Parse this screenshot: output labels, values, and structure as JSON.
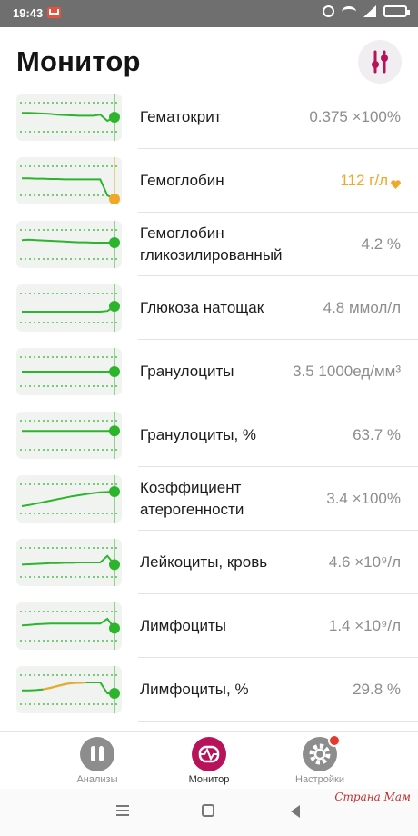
{
  "status_bar": {
    "time": "19:43"
  },
  "header": {
    "title": "Монитор",
    "filter_icon": "sliders-icon"
  },
  "colors": {
    "ok": "#2cb52c",
    "warn": "#f1a728",
    "accent": "#b8135a",
    "badge": "#e43a2e"
  },
  "items": [
    {
      "name": "Гематокрит",
      "value": "0.375 ×100%",
      "status": "ok",
      "trend": [
        62,
        62,
        61,
        60,
        59,
        57,
        56,
        55,
        54,
        54,
        54,
        57,
        40,
        50
      ]
    },
    {
      "name": "Гемоглобин",
      "value": "112 г/л",
      "status": "warn",
      "trend": [
        57,
        57,
        56,
        56,
        55,
        55,
        54,
        54,
        54,
        54,
        54,
        54,
        10,
        0
      ]
    },
    {
      "name": "Гемоглобин гликозилированный",
      "value": "4.2 %",
      "status": "ok",
      "trend": [
        62,
        63,
        62,
        61,
        60,
        59,
        58,
        57,
        56,
        56,
        55,
        55,
        55,
        55
      ]
    },
    {
      "name": "Глюкоза натощак",
      "value": "4.8 ммол/л",
      "status": "ok",
      "trend": [
        40,
        40,
        40,
        40,
        40,
        40,
        40,
        40,
        40,
        40,
        40,
        40,
        42,
        55
      ]
    },
    {
      "name": "Гранулоциты",
      "value": "3.5 1000ед/мм³",
      "status": "ok",
      "trend": [
        50,
        50,
        50,
        50,
        50,
        50,
        50,
        50,
        50,
        50,
        50,
        50,
        50,
        50
      ]
    },
    {
      "name": "Гранулоциты, %",
      "value": "63.7 %",
      "status": "ok",
      "trend": [
        62,
        62,
        62,
        62,
        62,
        62,
        62,
        62,
        62,
        62,
        62,
        62,
        62,
        62
      ]
    },
    {
      "name": "Коэффициент атерогенности",
      "value": "3.4 ×100%",
      "status": "ok",
      "trend": [
        30,
        33,
        37,
        41,
        45,
        49,
        53,
        57,
        60,
        63,
        66,
        68,
        69,
        70
      ]
    },
    {
      "name": "Лейкоциты, кровь",
      "value": "4.6 ×10⁹/л",
      "status": "ok",
      "trend": [
        44,
        45,
        46,
        47,
        48,
        48,
        49,
        49,
        50,
        50,
        50,
        50,
        68,
        44
      ]
    },
    {
      "name": "Лимфоциты",
      "value": "1.4 ×10⁹/л",
      "status": "ok",
      "trend": [
        52,
        53,
        55,
        56,
        57,
        57,
        57,
        57,
        57,
        57,
        57,
        57,
        70,
        44
      ]
    },
    {
      "name": "Лимфоциты, %",
      "value": "29.8 %",
      "status": "ok",
      "trend": [
        48,
        48,
        49,
        51,
        55,
        60,
        65,
        68,
        69,
        70,
        70,
        70,
        40,
        40
      ],
      "warn_segment": true
    }
  ],
  "bottom_nav": {
    "tabs": [
      {
        "label": "Анализы",
        "icon": "tubes-icon"
      },
      {
        "label": "Монитор",
        "icon": "monitor-pulse-icon"
      },
      {
        "label": "Настройки",
        "icon": "gear-icon"
      }
    ],
    "active": "Монитор"
  },
  "watermark": "Страна Мам"
}
